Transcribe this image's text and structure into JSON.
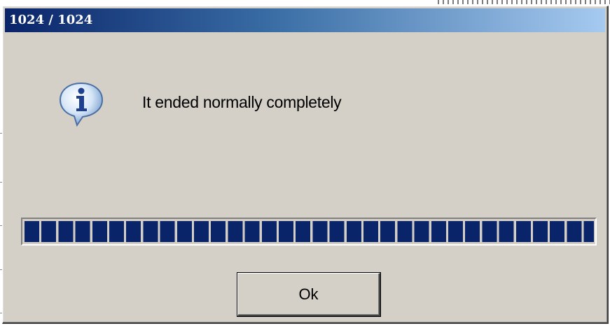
{
  "window": {
    "title": "1024 / 1024"
  },
  "dialog": {
    "icon": "info-icon",
    "message": "It ended normally completely",
    "ok_label": "Ok"
  },
  "progress": {
    "value": 1024,
    "max": 1024,
    "fraction": 1.0
  },
  "colors": {
    "title_gradient_start": "#0a246a",
    "title_gradient_end": "#a6caf0",
    "progress_fill": "#0a246a",
    "dialog_face": "#d4d0c8"
  }
}
